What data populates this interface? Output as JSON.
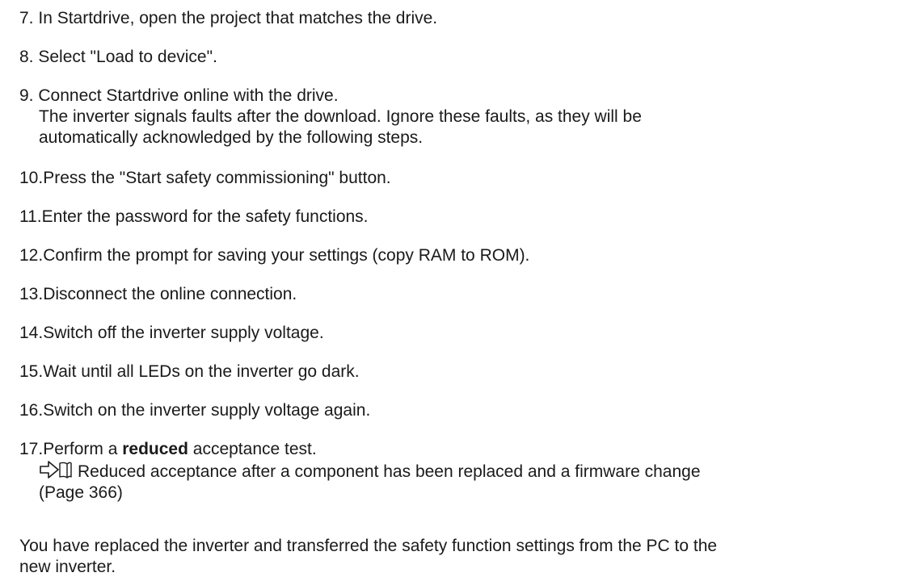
{
  "steps": [
    {
      "num": "7.",
      "text": "In Startdrive, open the project that matches the drive."
    },
    {
      "num": "8.",
      "text": "Select \"Load to device\"."
    },
    {
      "num": "9.",
      "text": "Connect Startdrive online with the drive.",
      "note_1": "The inverter signals faults after the download. Ignore these faults, as they will be",
      "note_2": "automatically acknowledged by the following steps."
    },
    {
      "num": "10.",
      "text": "Press the \"Start safety commissioning\" button."
    },
    {
      "num": "11.",
      "text": "Enter the password for the safety functions."
    },
    {
      "num": "12.",
      "text": "Confirm the prompt for saving your settings (copy RAM to ROM)."
    },
    {
      "num": "13.",
      "text": "Disconnect the online connection."
    },
    {
      "num": "14.",
      "text": "Switch off the inverter supply voltage."
    },
    {
      "num": "15.",
      "text": "Wait until all LEDs on the inverter go dark."
    },
    {
      "num": "16.",
      "text": "Switch on the inverter supply voltage again."
    },
    {
      "num": "17.",
      "text_before": "Perform a ",
      "text_bold": "reduced",
      "text_after": " acceptance test.",
      "xref_text": "Reduced acceptance after a component has been replaced and a firmware change",
      "xref_page": "(Page 366)"
    }
  ],
  "result": {
    "line_1": "You have replaced the inverter and transferred the safety function settings from the PC to the",
    "line_2": "new inverter."
  }
}
